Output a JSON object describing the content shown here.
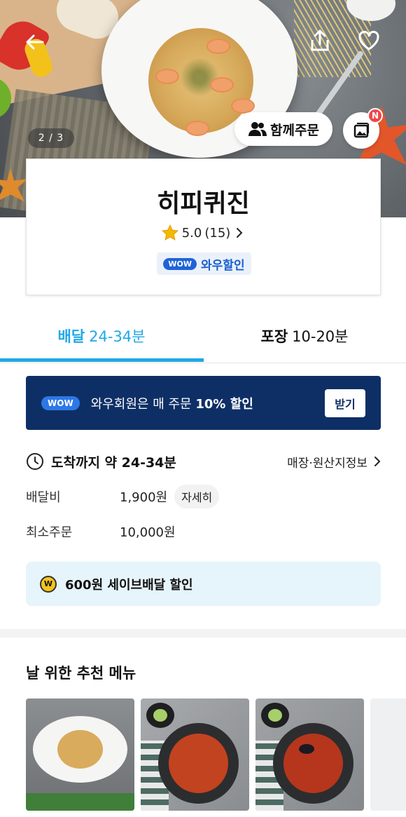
{
  "header": {
    "image_counter": "2 / 3",
    "group_order_label": "함께주문",
    "photo_badge": "N"
  },
  "store": {
    "name": "히피퀴진",
    "rating": "5.0",
    "review_count": "(15)",
    "wow_pill": "WOW",
    "wow_label": "와우할인"
  },
  "tabs": {
    "delivery": {
      "label": "배달",
      "time": "24-34분"
    },
    "pickup": {
      "label": "포장",
      "time": "10-20분"
    }
  },
  "banner": {
    "wow_pill": "WOW",
    "text_prefix": "와우회원은 매 주문 ",
    "text_bold": "10% 할인",
    "button_label": "받기"
  },
  "info": {
    "eta_label": "도착까지 약 24-34분",
    "store_info_link": "매장·원산지정보",
    "delivery_fee_label": "배달비",
    "delivery_fee_value": "1,900원",
    "detail_button": "자세히",
    "min_order_label": "최소주문",
    "min_order_value": "10,000원"
  },
  "save_delivery": {
    "coin_symbol": "W",
    "text": "600원 세이브배달 할인"
  },
  "recommend": {
    "title": "날 위한 추천 메뉴"
  },
  "colors": {
    "accent_blue": "#1fa8e6",
    "banner_navy": "#0e2f66",
    "wow_blue": "#1f63d8",
    "save_bg": "#e6f4fb",
    "badge_red": "#f0474e"
  },
  "icons": [
    "back-arrow-icon",
    "share-icon",
    "heart-icon",
    "group-icon",
    "photo-icon",
    "star-icon",
    "chevron-right-icon",
    "clock-icon",
    "coin-icon"
  ]
}
